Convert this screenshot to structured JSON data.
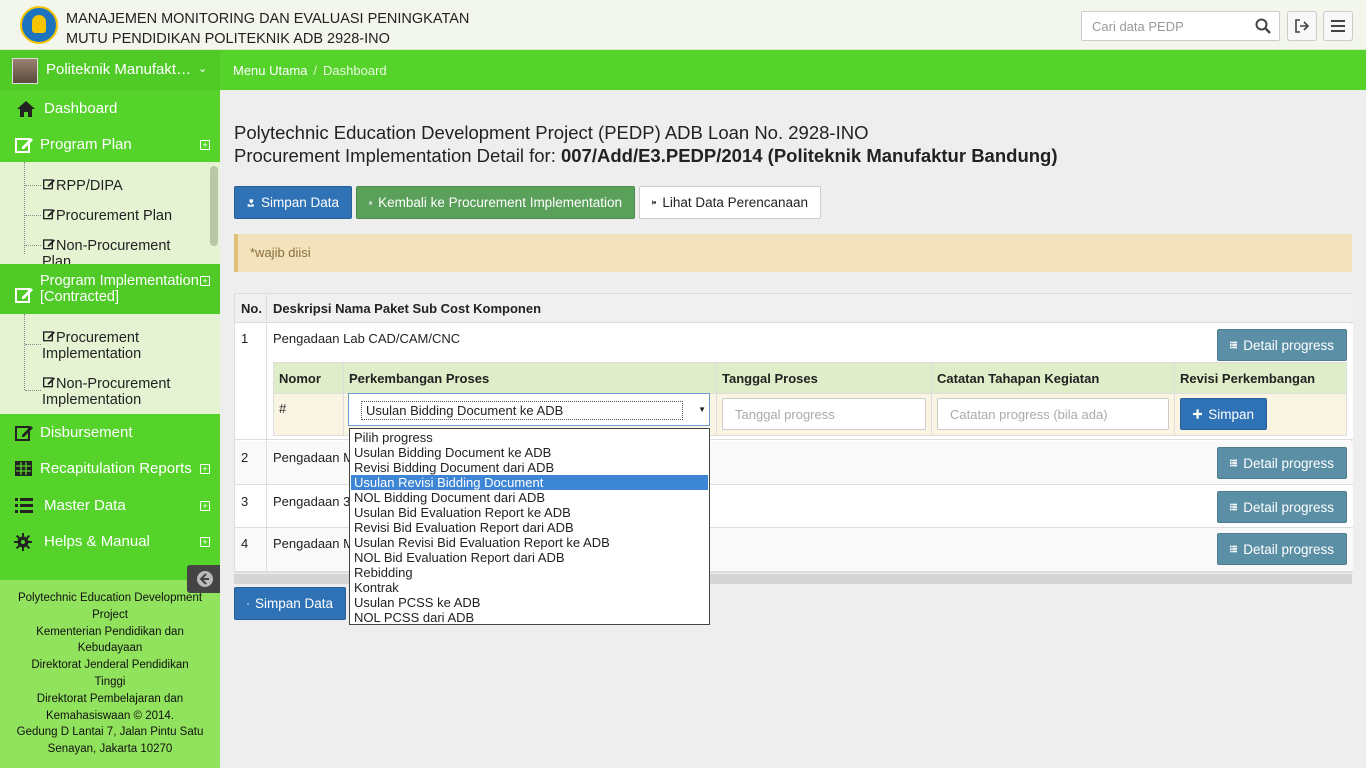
{
  "header": {
    "title_line1": "MANAJEMEN MONITORING DAN EVALUASI PENINGKATAN",
    "title_line2": "MUTU PENDIDIKAN POLITEKNIK ADB 2928-INO",
    "search_placeholder": "Cari data PEDP",
    "icons": [
      "search-icon",
      "logout-icon",
      "menu-icon"
    ]
  },
  "user": {
    "name": "Politeknik Manufaktur Bandung"
  },
  "breadcrumb": {
    "root": "Menu Utama",
    "current": "Dashboard"
  },
  "sidebar": {
    "dashboard": "Dashboard",
    "program_plan": "Program Plan",
    "plan_items": [
      "RPP/DIPA",
      "Procurement Plan",
      "Non-Procurement Plan"
    ],
    "program_impl_1": "Program Implementation",
    "program_impl_2": "[Contracted]",
    "impl_items": [
      [
        "Procurement",
        "Implementation"
      ],
      [
        "Non-Procurement",
        "Implementation"
      ]
    ],
    "disbursement": "Disbursement",
    "recap": "Recapitulation Reports",
    "master": "Master Data",
    "helps": "Helps & Manual",
    "expand_symbol": "+"
  },
  "footer": {
    "lines": [
      "Polytechnic Education Development",
      "Project",
      "Kementerian Pendidikan dan",
      "Kebudayaan",
      "Direktorat Jenderal Pendidikan",
      "Tinggi",
      "Direktorat Pembelajaran dan",
      "Kemahasiswaan © 2014.",
      "Gedung D Lantai 7, Jalan Pintu Satu",
      "Senayan, Jakarta 10270"
    ]
  },
  "page": {
    "heading_line1": "Polytechnic Education Development Project (PEDP) ADB Loan No. 2928-INO",
    "heading_line2_prefix": "Procurement Implementation Detail for: ",
    "heading_line2_bold": "007/Add/E3.PEDP/2014 (Politeknik Manufaktur Bandung)",
    "buttons": {
      "save": "Simpan Data",
      "back": "Kembali ke Procurement Implementation",
      "view_plan": "Lihat Data Perencanaan"
    },
    "alert": "*wajib diisi"
  },
  "table": {
    "headers": [
      "No.",
      "Deskripsi Nama Paket Sub Cost Komponen"
    ],
    "rows": [
      {
        "no": "1",
        "desc": "Pengadaan Lab CAD/CAM/CNC"
      },
      {
        "no": "2",
        "desc": "Pengadaan M"
      },
      {
        "no": "3",
        "desc": "Pengadaan 3"
      },
      {
        "no": "4",
        "desc": "Pengadaan M"
      }
    ],
    "detail_button": "Detail progress",
    "inner_headers": [
      "Nomor",
      "Perkembangan Proses",
      "Tanggal Proses",
      "Catatan Tahapan Kegiatan",
      "Revisi Perkembangan"
    ],
    "inner_row": {
      "nomor": "#",
      "selected": "Usulan Bidding Document ke ADB",
      "date_placeholder": "Tanggal progress",
      "note_placeholder": "Catatan progress (bila ada)",
      "save_button": "Simpan"
    }
  },
  "dropdown": {
    "options": [
      "Pilih progress",
      "Usulan Bidding Document ke ADB",
      "Revisi Bidding Document dari ADB",
      "Usulan Revisi Bidding Document",
      "NOL Bidding Document dari ADB",
      "Usulan Bid Evaluation Report ke ADB",
      "Revisi Bid Evaluation Report dari ADB",
      "Usulan Revisi Bid Evaluation Report ke ADB",
      "NOL Bid Evaluation Report dari ADB",
      "Rebidding",
      "Kontrak",
      "Usulan PCSS ke ADB",
      "NOL PCSS dari ADB"
    ],
    "highlighted_index": 3
  },
  "bottom": {
    "save": "Simpan Data"
  }
}
